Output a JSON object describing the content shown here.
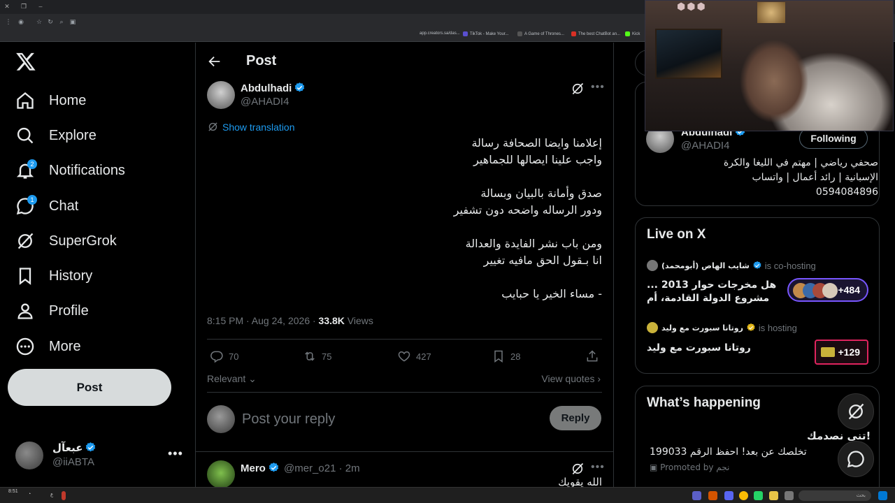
{
  "browser": {
    "bookmarks": [
      {
        "label": "app.creators.sa/das...",
        "color": "#5f6368"
      },
      {
        "label": "TikTok - Make Your...",
        "color": "#111111"
      },
      {
        "label": "A Game of Thrones...",
        "color": "#d93025"
      },
      {
        "label": "The best ChatBot an...",
        "color": "#222222"
      },
      {
        "label": "Kick",
        "color": "#53fc18"
      }
    ]
  },
  "nav": {
    "items": [
      {
        "label": "Home",
        "icon": "home-icon"
      },
      {
        "label": "Explore",
        "icon": "search-icon"
      },
      {
        "label": "Notifications",
        "icon": "bell-icon",
        "badge": "2"
      },
      {
        "label": "Chat",
        "icon": "chat-icon",
        "badge": "1"
      },
      {
        "label": "SuperGrok",
        "icon": "grok-icon"
      },
      {
        "label": "History",
        "icon": "bookmark-icon"
      },
      {
        "label": "Profile",
        "icon": "person-icon"
      },
      {
        "label": "More",
        "icon": "more-circle-icon"
      }
    ],
    "post_button": "Post",
    "account": {
      "name": "عبعآل",
      "handle": "@iiABTA",
      "more": "•••"
    }
  },
  "main": {
    "title": "Post",
    "author": {
      "name": "Abdulhadi",
      "handle": "@AHADI4"
    },
    "show_translation": "Show translation",
    "tweet_lines": [
      "إعلامنا وايضا الصحافة رسالة",
      "واجب علينا ايصالها للجماهير",
      "",
      "صدق وأمانة بالبيان وبسالة",
      "ودور الرساله واضحه دون تشفير",
      "",
      "ومن باب نشر الفايدة والعدالة",
      "انا بـقول الحق مافيه تغيير",
      "",
      "- مساء الخير يا حبايب"
    ],
    "meta": {
      "time": "8:15 PM · Aug 24, 2026 · ",
      "views_count": "33.8K",
      "views_label": " Views"
    },
    "actions": {
      "replies": "70",
      "reposts": "75",
      "likes": "427",
      "bookmarks": "28"
    },
    "sort_label": "Relevant",
    "view_quotes": "View quotes ›",
    "reply_placeholder": "Post your reply",
    "reply_button": "Reply",
    "next_reply": {
      "name": "Mero",
      "handle": "@mer_o21 · 2m",
      "text": "الله يقويك"
    }
  },
  "sidebar": {
    "profile": {
      "name": "Abdulhadi",
      "handle": "@AHADI4",
      "follow_button": "Following",
      "bio_lines": [
        "صحفي رياضي | مهتم في الليغا والكرة",
        "الإسبانية | رائد أعمال | واتساب",
        "0594084896"
      ]
    },
    "live": {
      "title": "Live on X",
      "items": [
        {
          "host": "شايب الهاص (أبومحمد)",
          "status": "is co-hosting",
          "title": "هل مخرجات حوار 2013 ... مشروع الدولة القادمة، أم",
          "count": "+484"
        },
        {
          "host": "روتانا سبورت مع وليد",
          "status": "is hosting",
          "title": "روتانا سبورت مع وليد",
          "count": "+129"
        }
      ]
    },
    "trends": {
      "title": "What’s happening",
      "promo_headline": "تنى نصدمك!",
      "promo_text": "تخلصك عن بعد! احفظ الرقم 199033",
      "promoted_by": "Promoted by نجم"
    }
  },
  "colors": {
    "accent": "#1d9bf0",
    "background": "#000000",
    "border": "#2f3336",
    "muted": "#71767b"
  },
  "taskbar": {
    "clock": "8:51",
    "search": "بحث"
  }
}
